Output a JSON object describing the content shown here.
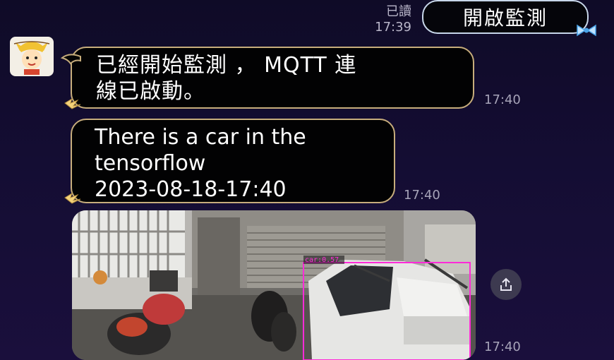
{
  "chat": {
    "outgoing": {
      "read_label": "已讀",
      "time": "17:39",
      "text": "開啟監測"
    },
    "incoming": [
      {
        "line1": "已經開始監測 ， MQTT 連",
        "line2": "線已啟動。",
        "time": "17:40"
      },
      {
        "line1": "There is a car in the",
        "line2": "tensorflow",
        "line3": "2023-08-18-17:40",
        "time": "17:40"
      }
    ],
    "image_message": {
      "detection_label": "car:0.57",
      "time": "17:40"
    }
  },
  "icons": {
    "avatar": "cartoon-avatar-icon",
    "share": "share-icon",
    "bubble_deco": "bow-deco-icon"
  },
  "colors": {
    "background": "#140d33",
    "bubble_in_border": "#c7ad7c",
    "bubble_out_border": "#c8d7ea",
    "detection_box": "#ff2bd8"
  }
}
